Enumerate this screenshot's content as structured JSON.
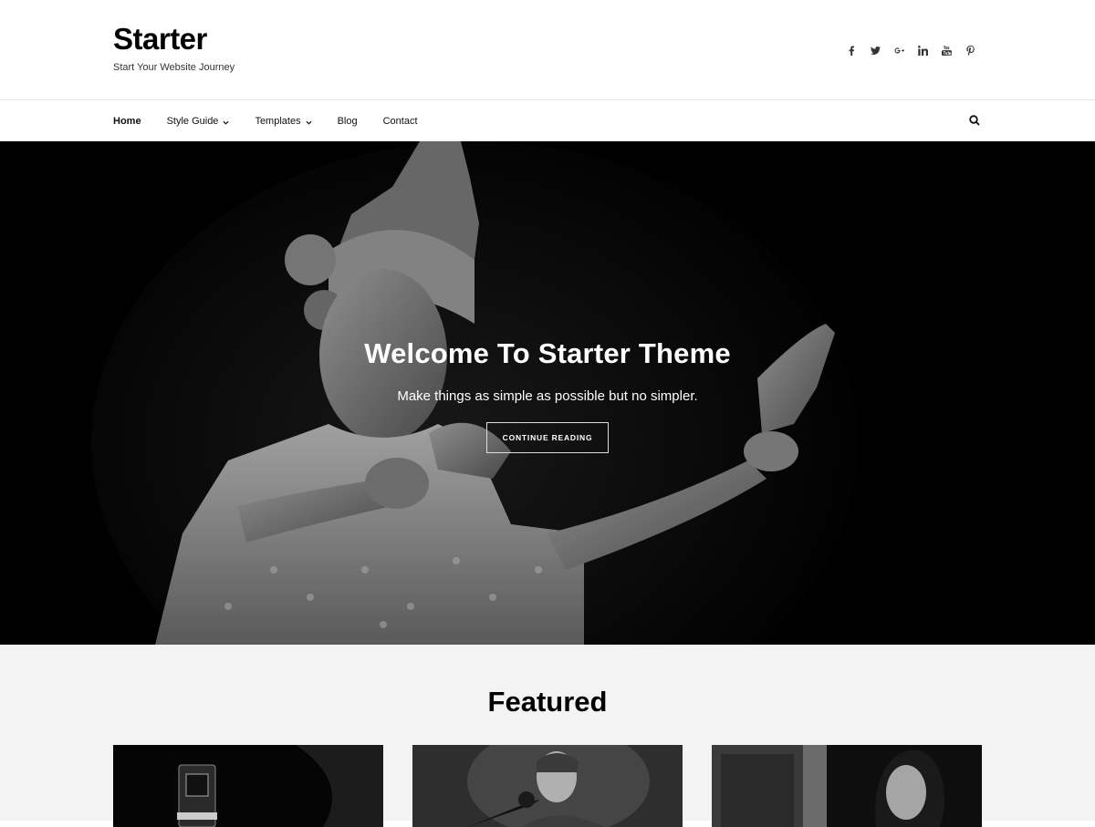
{
  "header": {
    "site_title": "Starter",
    "tagline": "Start Your Website Journey",
    "social_icons": [
      "facebook-icon",
      "twitter-icon",
      "google-plus-icon",
      "linkedin-icon",
      "youtube-icon",
      "pinterest-icon"
    ]
  },
  "nav": {
    "items": [
      {
        "label": "Home",
        "active": true,
        "dropdown": false
      },
      {
        "label": "Style Guide",
        "active": false,
        "dropdown": true
      },
      {
        "label": "Templates",
        "active": false,
        "dropdown": true
      },
      {
        "label": "Blog",
        "active": false,
        "dropdown": false
      },
      {
        "label": "Contact",
        "active": false,
        "dropdown": false
      }
    ],
    "search_icon": "search-icon"
  },
  "hero": {
    "title": "Welcome To Starter Theme",
    "subtitle": "Make things as simple as possible but no simpler.",
    "button_label": "CONTINUE READING"
  },
  "featured": {
    "title": "Featured"
  },
  "colors": {
    "accent": "#000000",
    "hero_bg": "#000000",
    "featured_bg": "#f3f3f3"
  }
}
